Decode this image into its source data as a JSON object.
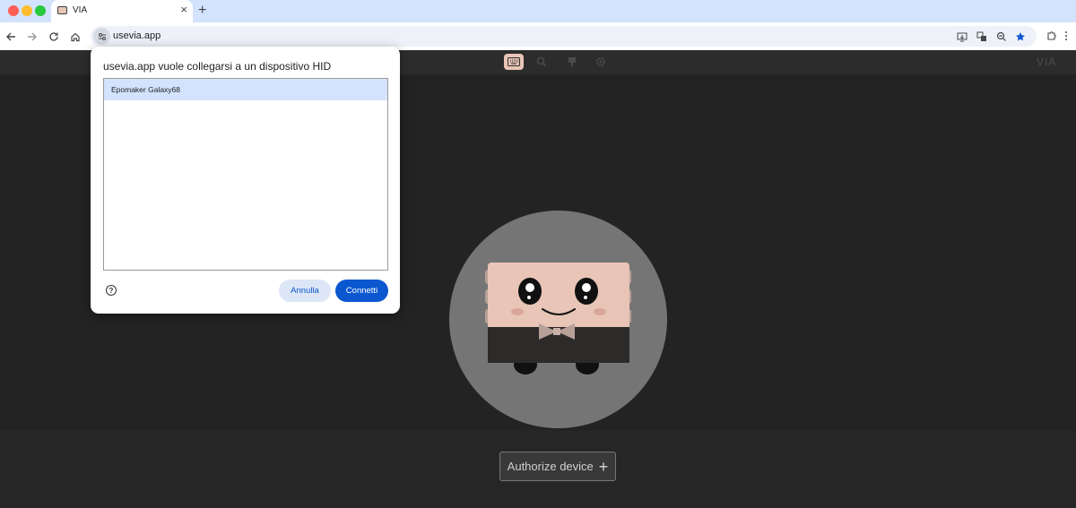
{
  "browser": {
    "tab": {
      "title": "VIA",
      "close_glyph": "×",
      "favicon": "keyboard-mascot-icon"
    },
    "new_tab_glyph": "+",
    "toolbar": {
      "back_icon": "arrow-left-icon",
      "forward_icon": "arrow-right-icon",
      "reload_icon": "reload-icon",
      "home_icon": "home-icon"
    },
    "omnibox": {
      "url": "usevia.app"
    }
  },
  "app": {
    "brand": "VIA",
    "nav_icons": [
      "keyboard-icon",
      "debug-icon",
      "design-icon",
      "settings-icon"
    ],
    "authorize_label": "Authorize device",
    "authorize_glyph": "+"
  },
  "dialog": {
    "title": "usevia.app vuole collegarsi a un dispositivo HID",
    "devices": [
      {
        "name": "Epomaker Galaxy68",
        "selected": true
      }
    ],
    "help_glyph": "?",
    "cancel_label": "Annulla",
    "connect_label": "Connetti"
  },
  "colors": {
    "accent": "#0b57d0",
    "selection": "#d3e3fd",
    "app_accent": "#e9c5b7"
  }
}
